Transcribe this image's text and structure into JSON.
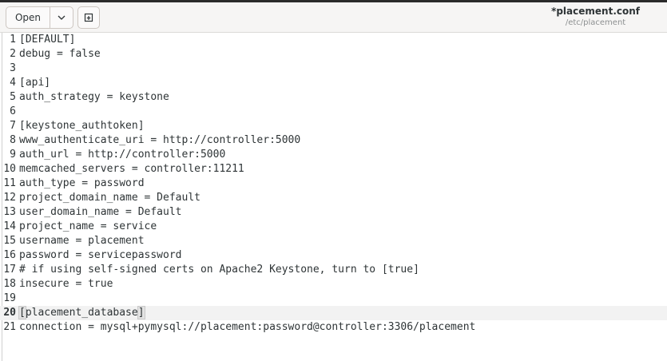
{
  "header": {
    "open_label": "Open",
    "title": "*placement.conf",
    "subtitle": "/etc/placement",
    "icons": {
      "dropdown": "chevron-down-icon",
      "new_tab": "new-tab-icon"
    }
  },
  "editor": {
    "current_line": 20,
    "lines": [
      {
        "n": "1",
        "text": "[DEFAULT]"
      },
      {
        "n": "2",
        "text": "debug = false"
      },
      {
        "n": "3",
        "text": ""
      },
      {
        "n": "4",
        "text": "[api]"
      },
      {
        "n": "5",
        "text": "auth_strategy = keystone"
      },
      {
        "n": "6",
        "text": ""
      },
      {
        "n": "7",
        "text": "[keystone_authtoken]"
      },
      {
        "n": "8",
        "text": "www_authenticate_uri = http://controller:5000"
      },
      {
        "n": "9",
        "text": "auth_url = http://controller:5000"
      },
      {
        "n": "10",
        "text": "memcached_servers = controller:11211"
      },
      {
        "n": "11",
        "text": "auth_type = password"
      },
      {
        "n": "12",
        "text": "project_domain_name = Default"
      },
      {
        "n": "13",
        "text": "user_domain_name = Default"
      },
      {
        "n": "14",
        "text": "project_name = service"
      },
      {
        "n": "15",
        "text": "username = placement"
      },
      {
        "n": "16",
        "text": "password = servicepassword"
      },
      {
        "n": "17",
        "text": "# if using self-signed certs on Apache2 Keystone, turn to [true]"
      },
      {
        "n": "18",
        "text": "insecure = true"
      },
      {
        "n": "19",
        "text": ""
      },
      {
        "n": "20",
        "open": "[",
        "inner": "placement_database",
        "close": "]"
      },
      {
        "n": "21",
        "text": "connection = mysql+pymysql://placement:password@controller:3306/placement"
      }
    ]
  },
  "colors": {
    "header_bg": "#f6f5f4",
    "editor_bg": "#ffffff",
    "current_line_bg": "#f2f2f2",
    "text": "#2e3436"
  }
}
